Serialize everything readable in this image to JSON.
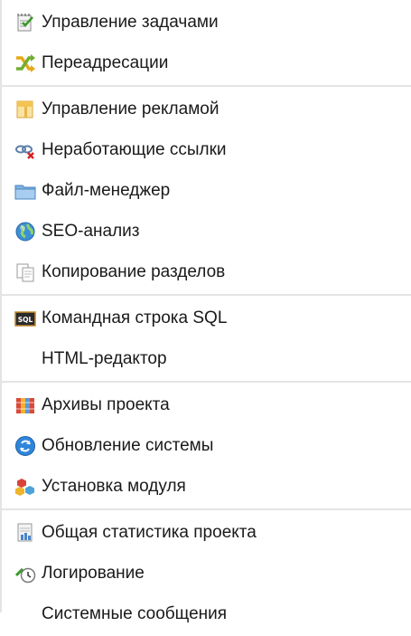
{
  "menu": {
    "groups": [
      {
        "items": [
          {
            "label": "Управление задачами",
            "icon": "task-checklist-icon"
          },
          {
            "label": "Переадресации",
            "icon": "redirect-arrows-icon"
          }
        ]
      },
      {
        "items": [
          {
            "label": "Управление рекламой",
            "icon": "banner-ad-icon"
          },
          {
            "label": "Неработающие ссылки",
            "icon": "broken-link-icon"
          },
          {
            "label": "Файл-менеджер",
            "icon": "folder-icon"
          },
          {
            "label": "SEO-анализ",
            "icon": "globe-icon"
          },
          {
            "label": "Копирование разделов",
            "icon": "copy-documents-icon"
          }
        ]
      },
      {
        "items": [
          {
            "label": "Командная строка SQL",
            "icon": "sql-console-icon"
          },
          {
            "label": "HTML-редактор",
            "icon": ""
          }
        ]
      },
      {
        "items": [
          {
            "label": "Архивы проекта",
            "icon": "archive-books-icon"
          },
          {
            "label": "Обновление системы",
            "icon": "update-refresh-icon"
          },
          {
            "label": "Установка модуля",
            "icon": "install-cubes-icon"
          }
        ]
      },
      {
        "items": [
          {
            "label": "Общая статистика проекта",
            "icon": "statistics-document-icon"
          },
          {
            "label": "Логирование",
            "icon": "logging-clock-icon"
          },
          {
            "label": "Системные сообщения",
            "icon": ""
          }
        ]
      }
    ]
  }
}
